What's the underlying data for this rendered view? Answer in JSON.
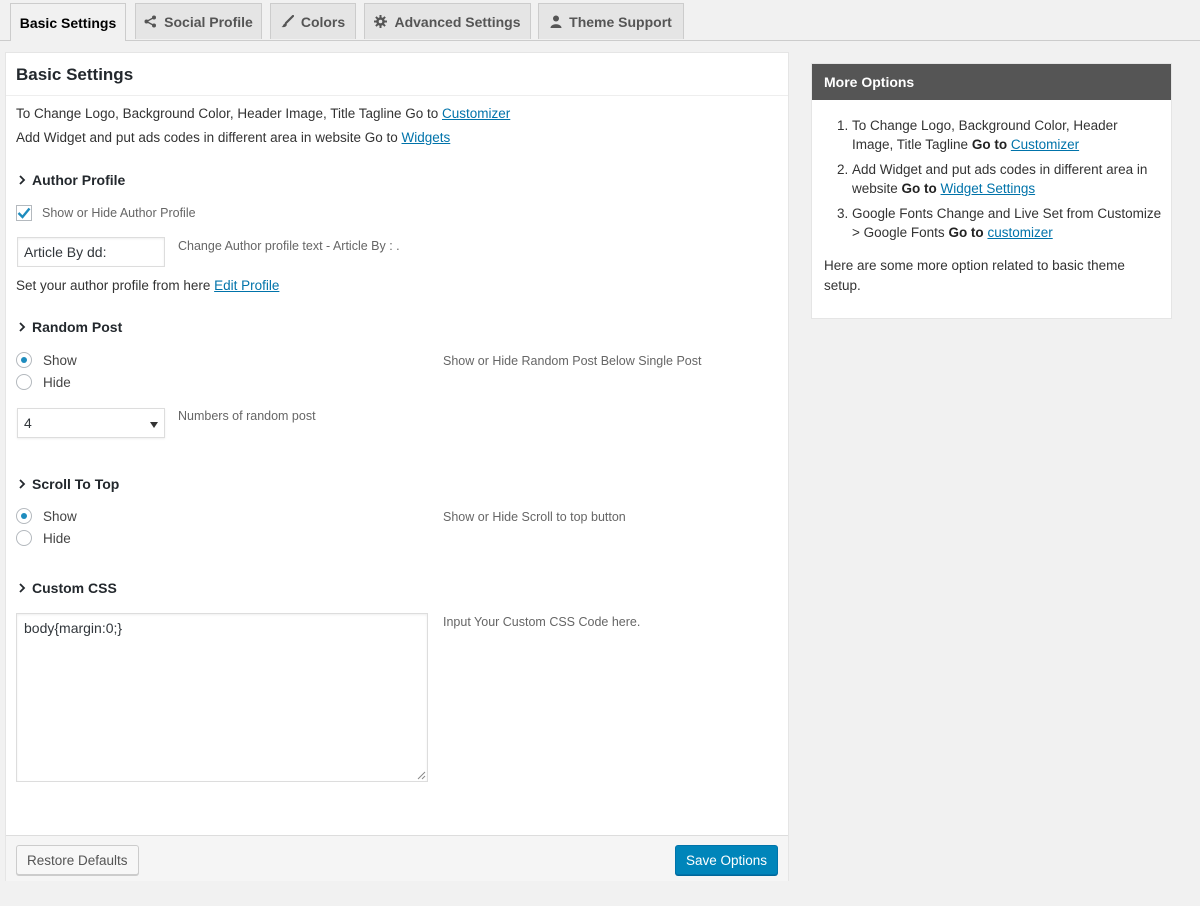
{
  "tabs": [
    {
      "label": "Basic Settings",
      "icon": "none",
      "active": true
    },
    {
      "label": "Social Profile",
      "icon": "share-icon"
    },
    {
      "label": "Colors",
      "icon": "brush-icon"
    },
    {
      "label": "Advanced Settings",
      "icon": "gear-icon"
    },
    {
      "label": "Theme Support",
      "icon": "user-icon"
    }
  ],
  "panel": {
    "title": "Basic Settings",
    "intro1_text": "To Change Logo, Background Color, Header Image, Title Tagline Go to ",
    "intro1_link": "Customizer",
    "intro2_text": "Add Widget and put ads codes in different area in website Go to ",
    "intro2_link": "Widgets"
  },
  "author": {
    "title": "Author Profile",
    "checkbox_label": "Show or Hide Author Profile",
    "checked": true,
    "input_value": "Article By dd:",
    "input_desc": "Change Author profile text - Article By : .",
    "edit_text": "Set your author profile from here ",
    "edit_link": "Edit Profile"
  },
  "random_post": {
    "title": "Random Post",
    "show_label": "Show",
    "hide_label": "Hide",
    "selected": "show",
    "desc": "Show or Hide Random Post Below Single Post",
    "select_value": "4",
    "select_desc": "Numbers of random post"
  },
  "scroll_top": {
    "title": "Scroll To Top",
    "show_label": "Show",
    "hide_label": "Hide",
    "selected": "show",
    "desc": "Show or Hide Scroll to top button"
  },
  "custom_css": {
    "title": "Custom CSS",
    "value": "body{margin:0;}",
    "desc": "Input Your Custom CSS Code here."
  },
  "footer": {
    "restore_label": "Restore Defaults",
    "save_label": "Save Options"
  },
  "sidebar": {
    "title": "More Options",
    "item1_text": "To Change Logo, Background Color, Header Image, Title Tagline ",
    "item1_bold": "Go to",
    "item1_link": "Customizer",
    "item2_text": "Add Widget and put ads codes in different area in website ",
    "item2_bold": "Go to",
    "item2_link": "Widget Settings",
    "item3_text": "Google Fonts Change and Live Set from Customize > Google Fonts ",
    "item3_bold": "Go to",
    "item3_link": "customizer",
    "note": "Here are some more option related to basic theme setup."
  },
  "colors": {
    "primary": "#0085ba",
    "link": "#0073aa",
    "sidebar_header": "#555555",
    "radio_dot": "#1e8cbe"
  }
}
